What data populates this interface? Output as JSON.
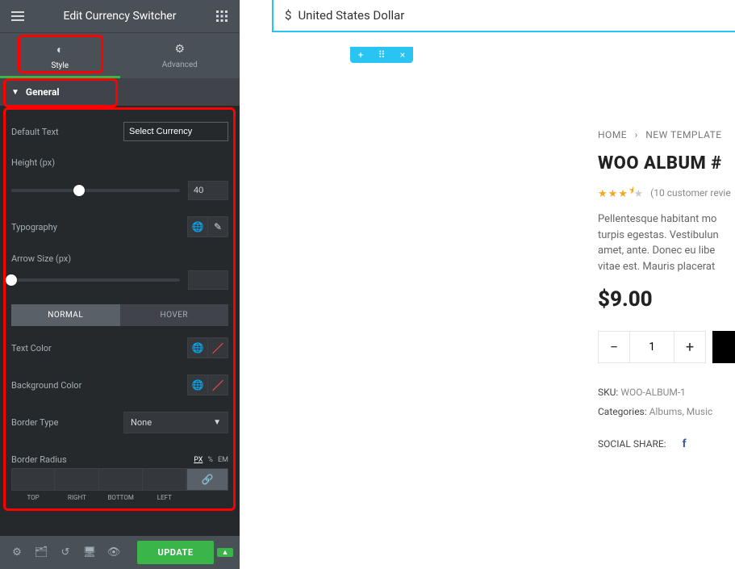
{
  "header": {
    "title": "Edit Currency Switcher"
  },
  "tabs": {
    "style": "Style",
    "advanced": "Advanced"
  },
  "section": {
    "title": "General"
  },
  "controls": {
    "default_text": {
      "label": "Default Text",
      "value": "Select Currency"
    },
    "height": {
      "label": "Height (px)",
      "value": "40",
      "thumb_pct": 40
    },
    "typography": {
      "label": "Typography"
    },
    "arrow_size": {
      "label": "Arrow Size (px)",
      "value": "",
      "thumb_pct": 0
    },
    "states": {
      "normal": "NORMAL",
      "hover": "HOVER"
    },
    "text_color": {
      "label": "Text Color"
    },
    "bg_color": {
      "label": "Background Color"
    },
    "border_type": {
      "label": "Border Type",
      "value": "None"
    },
    "border_radius": {
      "label": "Border Radius",
      "units": {
        "px": "PX",
        "pct": "%",
        "em": "EM"
      },
      "sides": {
        "top": "TOP",
        "right": "RIGHT",
        "bottom": "BOTTOM",
        "left": "LEFT"
      }
    }
  },
  "footer": {
    "update": "UPDATE"
  },
  "preview": {
    "currency": {
      "symbol": "$",
      "name": "United States Dollar"
    },
    "breadcrumb": {
      "home": "HOME",
      "page": "NEW TEMPLATE"
    },
    "product_title": "WOO ALBUM #",
    "reviews": "(10 customer revie",
    "description": "Pellentesque habitant mo\nturpis egestas. Vestibulun\namet, ante. Donec eu libe\nvitae est. Mauris placerat",
    "price": "$9.00",
    "qty": "1",
    "sku_label": "SKU:",
    "sku_value": "WOO-ALBUM-1",
    "cat_label": "Categories:",
    "cat_values": "Albums, Music",
    "social_label": "SOCIAL SHARE:"
  }
}
